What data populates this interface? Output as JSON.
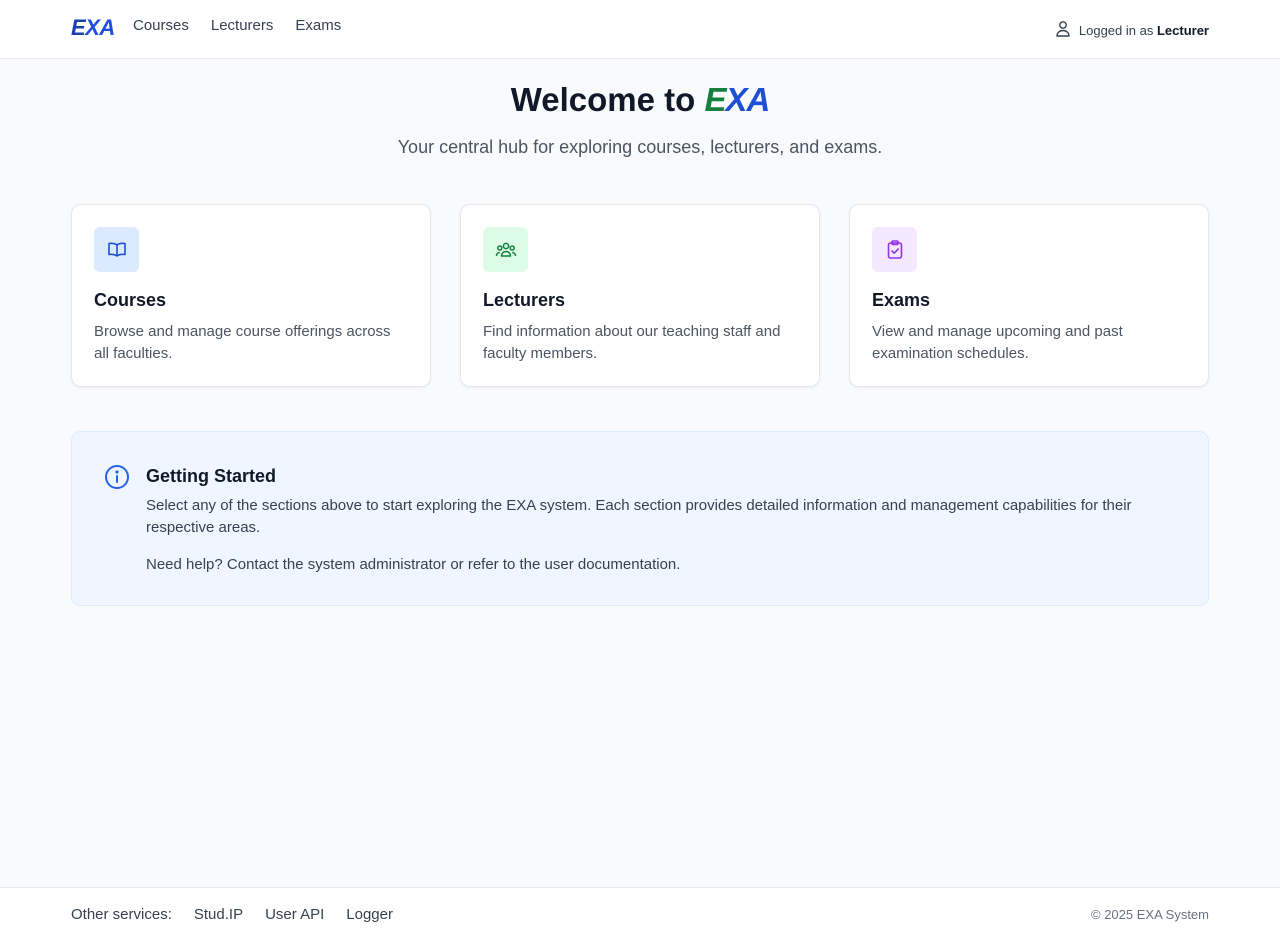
{
  "header": {
    "logo": {
      "part1": "E",
      "part2": "XA"
    },
    "nav": [
      "Courses",
      "Lecturers",
      "Exams"
    ],
    "user_prefix": "Logged in as",
    "user_role": "Lecturer"
  },
  "hero": {
    "title_prefix": "Welcome to",
    "title_brand": "EXA",
    "subtitle": "Your central hub for exploring courses, lecturers, and exams."
  },
  "cards": [
    {
      "title": "Courses",
      "description": "Browse and manage course offerings across all faculties.",
      "icon": "book-icon",
      "icon_color": "#1d4ed8",
      "icon_bg": "#dbeafe"
    },
    {
      "title": "Lecturers",
      "description": "Find information about our teaching staff and faculty members.",
      "icon": "users-icon",
      "icon_color": "#15803d",
      "icon_bg": "#dcfce7"
    },
    {
      "title": "Exams",
      "description": "View and manage upcoming and past examination schedules.",
      "icon": "clipboard-check-icon",
      "icon_color": "#9333ea",
      "icon_bg": "#f3e8ff"
    }
  ],
  "info": {
    "title": "Getting Started",
    "text1": "Select any of the sections above to start exploring the EXA system. Each section provides detailed information and management capabilities for their respective areas.",
    "text2": "Need help? Contact the system administrator or refer to the user documentation.",
    "icon": "info-icon"
  },
  "footer": {
    "label": "Other services:",
    "links": [
      "Stud.IP",
      "User API",
      "Logger"
    ],
    "copyright": "© 2025 EXA System"
  }
}
